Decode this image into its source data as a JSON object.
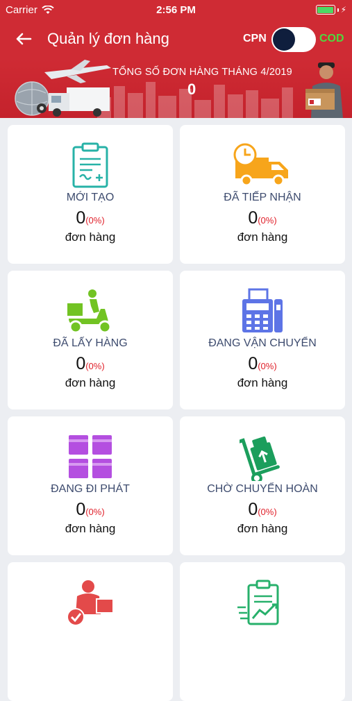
{
  "status_bar": {
    "carrier": "Carrier",
    "time": "2:56 PM"
  },
  "header": {
    "title": "Quản lý đơn hàng",
    "cpn_label": "CPN",
    "cod_label": "COD"
  },
  "banner": {
    "title": "TỔNG SỐ ĐƠN HÀNG THÁNG 4/2019",
    "total": "0"
  },
  "cards": [
    {
      "label": "MỚI TẠO",
      "count": "0",
      "percent": "(0%)",
      "unit": "đơn hàng",
      "icon": "clipboard-icon"
    },
    {
      "label": "ĐÃ TIẾP NHẬN",
      "count": "0",
      "percent": "(0%)",
      "unit": "đơn hàng",
      "icon": "delivery-truck-clock-icon"
    },
    {
      "label": "ĐÃ LẤY HÀNG",
      "count": "0",
      "percent": "(0%)",
      "unit": "đơn hàng",
      "icon": "scooter-delivery-icon"
    },
    {
      "label": "ĐANG VẬN CHUYỂN",
      "count": "0",
      "percent": "(0%)",
      "unit": "đơn hàng",
      "icon": "fax-machine-icon"
    },
    {
      "label": "ĐANG ĐI PHÁT",
      "count": "0",
      "percent": "(0%)",
      "unit": "đơn hàng",
      "icon": "stacked-boxes-icon"
    },
    {
      "label": "CHỜ CHUYỂN HOÀN",
      "count": "0",
      "percent": "(0%)",
      "unit": "đơn hàng",
      "icon": "hand-truck-icon"
    },
    {
      "label": "",
      "count": "",
      "percent": "",
      "unit": "",
      "icon": "person-box-check-icon"
    },
    {
      "label": "",
      "count": "",
      "percent": "",
      "unit": "",
      "icon": "clipboard-chart-icon"
    }
  ],
  "colors": {
    "primary_red": "#cf2b34",
    "cod_green": "#4fd83f",
    "percent_red": "#e0202a"
  }
}
